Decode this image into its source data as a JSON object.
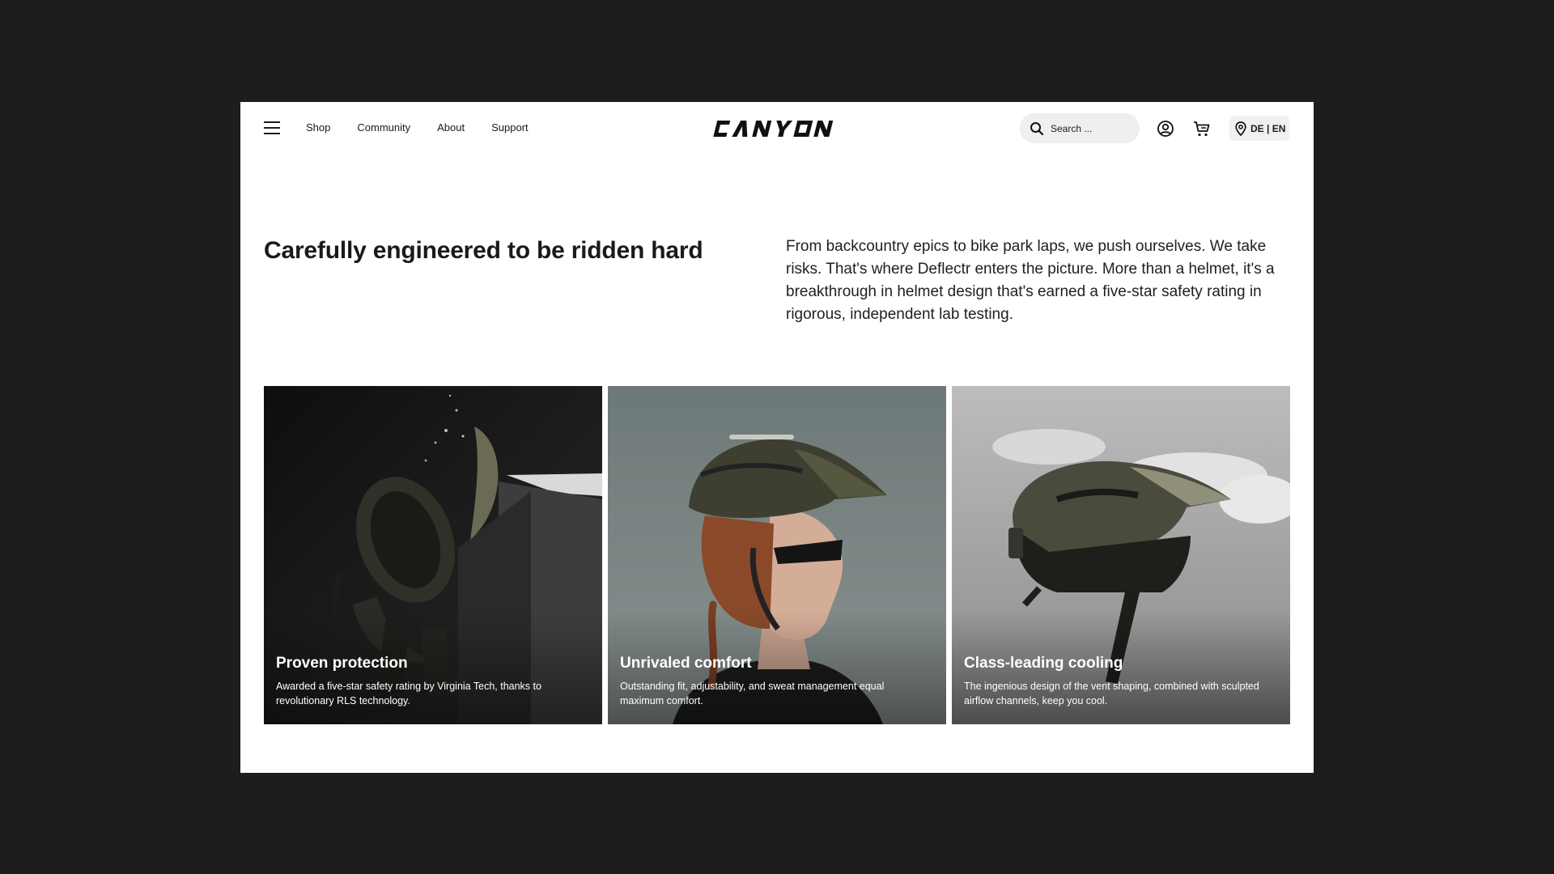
{
  "nav": {
    "items": [
      "Shop",
      "Community",
      "About",
      "Support"
    ]
  },
  "brand": {
    "logo_text": "CANYON"
  },
  "search": {
    "placeholder": "Search ..."
  },
  "locale": {
    "label": "DE | EN"
  },
  "intro": {
    "headline": "Carefully engineered to be ridden hard",
    "body": "From backcountry epics to bike park laps, we push ourselves. We take risks. That's where Deflectr enters the picture. More than a helmet, it's a breakthrough in helmet design that's earned a five-star safety rating in rigorous, independent lab testing."
  },
  "cards": [
    {
      "title": "Proven protection",
      "desc": "Awarded a five-star safety rating by Virginia Tech, thanks to revolutionary RLS technology."
    },
    {
      "title": "Unrivaled comfort",
      "desc": "Outstanding fit, adjustability, and sweat management equal maximum comfort."
    },
    {
      "title": "Class-leading cooling",
      "desc": "The ingenious design of the vent shaping, combined with sculpted airflow channels, keep you cool."
    }
  ],
  "icons": {
    "menu": "hamburger-menu-icon",
    "search": "search-icon",
    "account": "account-icon",
    "cart": "cart-icon",
    "location": "location-pin-icon"
  },
  "colors": {
    "background": "#1d1d1d",
    "page": "#ffffff",
    "text": "#1a1a1a",
    "search_bg": "#efefef"
  }
}
